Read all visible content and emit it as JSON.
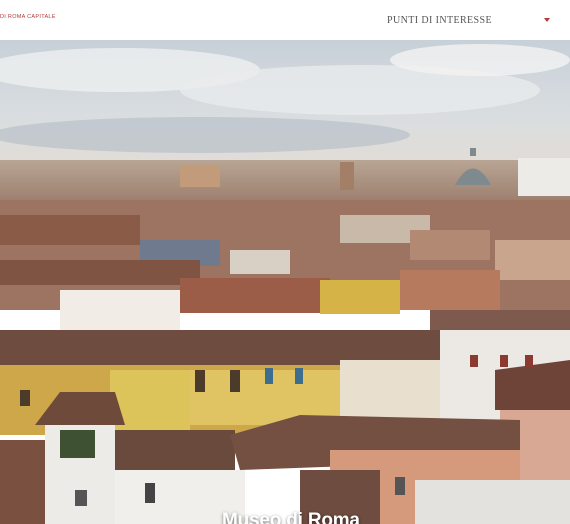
{
  "header": {
    "brand": "DI ROMA CAPITALE",
    "menu_label": "PUNTI DI INTERESSE",
    "menu_icon": "caret-down-icon"
  },
  "hero": {
    "image_alt": "Rome rooftops panorama",
    "title": "Museo di Roma"
  },
  "colors": {
    "accent": "#b23a3a",
    "sky": "#c9d3dc",
    "roof": "#8b5a45",
    "wall_yellow": "#d7b64a",
    "wall_white": "#ebe6de"
  }
}
